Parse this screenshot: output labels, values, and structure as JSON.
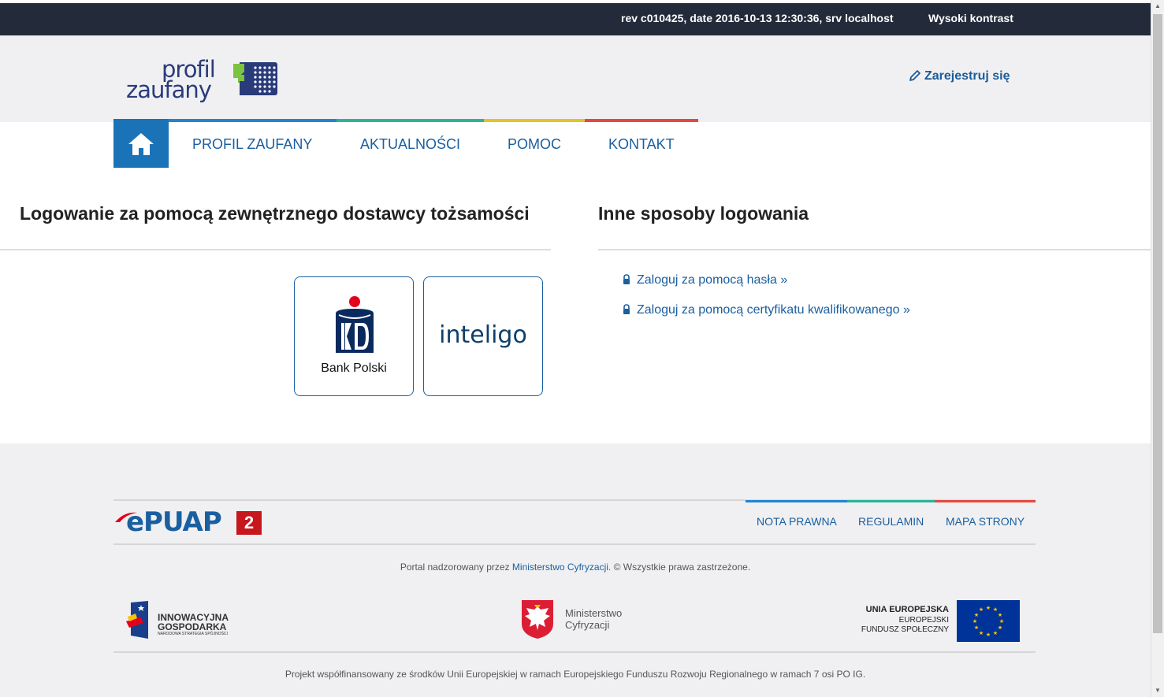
{
  "topbar": {
    "revision": "rev c010425, date 2016-10-13 12:30:36, srv localhost",
    "contrast_label": "Wysoki kontrast"
  },
  "header": {
    "logo_line1": "profil",
    "logo_line2": "zaufany",
    "register_label": "Zarejestruj się"
  },
  "nav": {
    "items": [
      {
        "label": "PROFIL ZAUFANY",
        "color": "#1f86cf"
      },
      {
        "label": "AKTUALNOŚCI",
        "color": "#2bb39a"
      },
      {
        "label": "POMOC",
        "color": "#e5c229"
      },
      {
        "label": "KONTAKT",
        "color": "#e5483f"
      }
    ]
  },
  "login": {
    "external_heading": "Logowanie za pomocą zewnętrznego dostawcy tożsamości",
    "providers": [
      {
        "name": "Bank Polski",
        "icon": "pko-logo"
      },
      {
        "name": "inteligo",
        "icon": "inteligo-logo"
      }
    ],
    "other_heading": "Inne sposoby logowania",
    "other_links": [
      {
        "label": "Zaloguj za pomocą hasła »"
      },
      {
        "label": "Zaloguj za pomocą certyfikatu kwalifikowanego »"
      }
    ]
  },
  "footer": {
    "epuap_logo": "ePUAP",
    "epuap_version": "2",
    "links": [
      {
        "label": "NOTA PRAWNA",
        "color": "#1f86cf"
      },
      {
        "label": "REGULAMIN",
        "color": "#2bb39a"
      },
      {
        "label": "MAPA STRONY",
        "color": "#e5483f"
      }
    ],
    "copyright_prefix": "Portal nadzorowany przez ",
    "copyright_link": "Ministerstwo Cyfryzacji",
    "copyright_suffix": ". © Wszystkie prawa zastrzeżone.",
    "logos": {
      "ig_line1": "INNOWACYJNA",
      "ig_line2": "GOSPODARKA",
      "ig_line3": "NARODOWA STRATEGIA SPÓJNOŚCI",
      "mc_line1": "Ministerstwo",
      "mc_line2": "Cyfryzacji",
      "eu_line1": "UNIA EUROPEJSKA",
      "eu_line2": "EUROPEJSKI",
      "eu_line3": "FUNDUSZ SPOŁECZNY"
    },
    "project_note": "Projekt współfinansowany ze środków Unii Europejskiej w ramach Europejskiego Funduszu Rozwoju Regionalnego w ramach 7 osi PO IG."
  }
}
